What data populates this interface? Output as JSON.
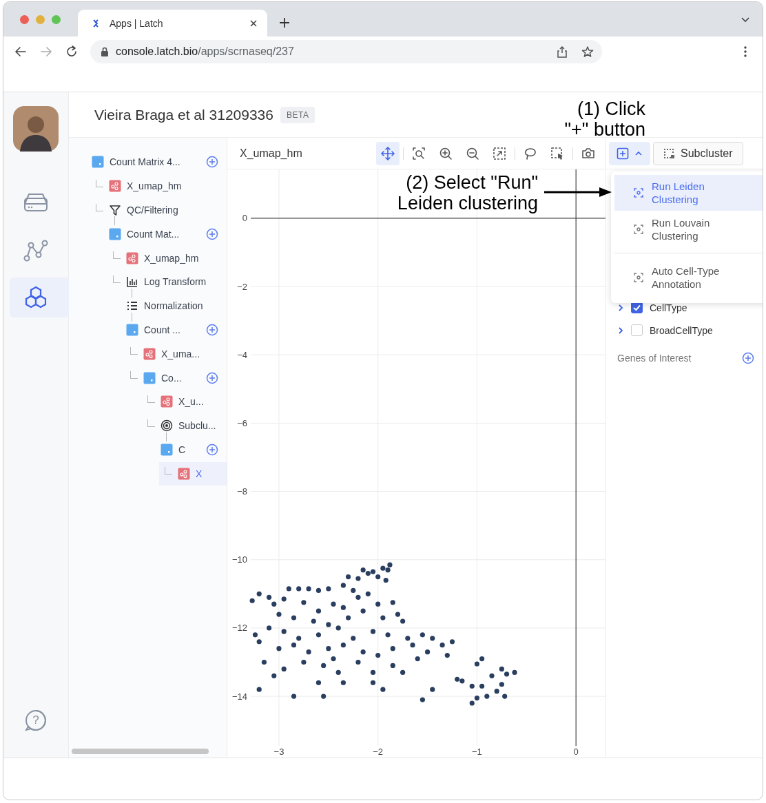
{
  "browser": {
    "tab_title": "Apps | Latch",
    "url": "console.latch.bio/apps/scrnaseq/237"
  },
  "rail": {
    "items": [
      {
        "kind": "drive",
        "selected": false
      },
      {
        "kind": "graph",
        "selected": false
      },
      {
        "kind": "cells",
        "selected": true
      }
    ],
    "help_glyph": "?"
  },
  "header": {
    "title": "Vieira Braga et al 31209336",
    "badge": "BETA"
  },
  "tree": [
    {
      "label": "Count Matrix 4...",
      "kind": "matrix",
      "add": true,
      "selected": false,
      "children": [
        {
          "label": "X_umap_hm",
          "kind": "umap",
          "add": false,
          "selected": false
        },
        {
          "label": "QC/Filtering",
          "kind": "filter",
          "add": false,
          "selected": false,
          "children": [
            {
              "label": "Count Mat...",
              "kind": "matrix",
              "add": true,
              "selected": false,
              "children": [
                {
                  "label": "X_umap_hm",
                  "kind": "umap",
                  "add": false,
                  "selected": false
                },
                {
                  "label": "Log Transform",
                  "kind": "bars",
                  "add": false,
                  "selected": false,
                  "children": [
                    {
                      "label": "Normalization",
                      "kind": "list",
                      "add": false,
                      "selected": false,
                      "children": [
                        {
                          "label": "Count ...",
                          "kind": "matrix",
                          "add": true,
                          "selected": false,
                          "children": [
                            {
                              "label": "X_uma...",
                              "kind": "umap",
                              "add": false,
                              "selected": false
                            },
                            {
                              "label": "Co...",
                              "kind": "matrix",
                              "add": true,
                              "selected": false,
                              "children": [
                                {
                                  "label": "X_u...",
                                  "kind": "umap",
                                  "add": false,
                                  "selected": false
                                },
                                {
                                  "label": "Subclu...",
                                  "kind": "target",
                                  "add": false,
                                  "selected": false,
                                  "children": [
                                    {
                                      "label": "C",
                                      "kind": "matrix",
                                      "add": true,
                                      "selected": false,
                                      "children": [
                                        {
                                          "label": "X",
                                          "kind": "umap",
                                          "add": false,
                                          "selected": true
                                        }
                                      ]
                                    }
                                  ]
                                }
                              ]
                            }
                          ]
                        }
                      ]
                    }
                  ]
                }
              ]
            }
          ]
        }
      ]
    }
  ],
  "plot": {
    "title": "X_umap_hm",
    "tool_groups": [
      [
        {
          "kind": "pan",
          "selected": true
        }
      ],
      [
        {
          "kind": "zoom-box",
          "selected": false
        },
        {
          "kind": "zoom-in",
          "selected": false
        },
        {
          "kind": "zoom-out",
          "selected": false
        },
        {
          "kind": "autoscale",
          "selected": false
        }
      ],
      [
        {
          "kind": "lasso",
          "selected": false
        },
        {
          "kind": "box-select",
          "selected": false
        }
      ],
      [
        {
          "kind": "camera",
          "selected": false
        }
      ]
    ],
    "chart_data": {
      "type": "scatter",
      "grid": true,
      "xlim": [
        -3.285,
        0.298
      ],
      "ylim": [
        -15.45,
        1.43
      ],
      "xticks": [
        {
          "value": -3,
          "label": "−3"
        },
        {
          "value": -2,
          "label": "−2"
        },
        {
          "value": -1,
          "label": "−1"
        },
        {
          "value": 0,
          "label": "0"
        }
      ],
      "yticks": [
        {
          "value": 0,
          "label": "0"
        },
        {
          "value": -2,
          "label": "−2"
        },
        {
          "value": -4,
          "label": "−4"
        },
        {
          "value": -6,
          "label": "−6"
        },
        {
          "value": -8,
          "label": "−8"
        },
        {
          "value": -10,
          "label": "−10"
        },
        {
          "value": -12,
          "label": "−12"
        },
        {
          "value": -14,
          "label": "−14"
        }
      ],
      "x": [
        -2.15,
        -2.1,
        -2.05,
        -1.95,
        -1.9,
        -1.88,
        -2.0,
        -1.92,
        -2.2,
        -2.3,
        -2.35,
        -2.25,
        -3.27,
        -3.2,
        -3.1,
        -3.05,
        -2.9,
        -2.8,
        -2.7,
        -2.6,
        -2.5,
        -2.95,
        -2.75,
        -2.6,
        -2.45,
        -2.35,
        -2.2,
        -2.1,
        -2.0,
        -1.85,
        -1.8,
        -3.0,
        -2.85,
        -2.65,
        -2.5,
        -2.3,
        -2.15,
        -1.95,
        -1.75,
        -3.1,
        -2.95,
        -2.8,
        -2.6,
        -2.4,
        -2.25,
        -2.05,
        -1.9,
        -1.7,
        -1.55,
        -1.45,
        -3.2,
        -3.0,
        -2.85,
        -2.7,
        -2.5,
        -2.35,
        -2.15,
        -2.0,
        -1.85,
        -1.65,
        -1.35,
        -1.25,
        -1.3,
        -3.15,
        -2.95,
        -2.75,
        -2.55,
        -2.4,
        -2.2,
        -2.05,
        -1.85,
        -1.75,
        -3.05,
        -2.6,
        -2.35,
        -2.05,
        -1.95,
        -3.2,
        -2.85,
        -2.55,
        -3.24,
        -2.45,
        -1.6,
        -1.5,
        -1.2,
        -1.15,
        -1.05,
        -0.95,
        -0.85,
        -0.75,
        -0.7,
        -0.62,
        -0.75,
        -0.8,
        -0.9,
        -1.0,
        -1.05,
        -0.72,
        -0.95,
        -1.0,
        -1.55,
        -1.45
      ],
      "series": [
        {
          "color": "#2a3f5f",
          "values": [
            -10.3,
            -10.4,
            -10.35,
            -10.25,
            -10.3,
            -10.15,
            -10.5,
            -10.6,
            -10.55,
            -10.5,
            -10.75,
            -10.9,
            -11.2,
            -11.0,
            -11.1,
            -11.3,
            -10.85,
            -10.85,
            -10.85,
            -10.9,
            -10.85,
            -11.15,
            -11.25,
            -11.5,
            -11.3,
            -11.4,
            -11.1,
            -11.0,
            -11.3,
            -11.25,
            -11.6,
            -11.6,
            -11.7,
            -11.8,
            -11.9,
            -11.7,
            -11.5,
            -11.7,
            -11.8,
            -12.0,
            -12.1,
            -12.3,
            -12.2,
            -12.0,
            -12.3,
            -12.1,
            -12.2,
            -12.3,
            -12.2,
            -12.3,
            -12.4,
            -12.6,
            -12.5,
            -12.7,
            -12.6,
            -12.5,
            -12.7,
            -12.8,
            -12.6,
            -12.5,
            -12.5,
            -12.4,
            -12.8,
            -13.0,
            -13.2,
            -13.0,
            -13.1,
            -13.3,
            -13.0,
            -13.3,
            -13.1,
            -13.3,
            -13.4,
            -13.6,
            -13.6,
            -13.6,
            -13.8,
            -13.8,
            -14.0,
            -14.0,
            -12.2,
            -12.9,
            -12.9,
            -12.7,
            -13.5,
            -13.55,
            -13.7,
            -13.7,
            -13.4,
            -13.2,
            -13.35,
            -13.3,
            -13.65,
            -13.85,
            -14.0,
            -14.05,
            -14.2,
            -14.0,
            -12.9,
            -13.05,
            -14.1,
            -13.8
          ]
        }
      ]
    }
  },
  "actions": {
    "add_menu_expanded": true,
    "subcluster": "Subcluster"
  },
  "menu": {
    "items": [
      {
        "label": "Run Leiden Clustering",
        "selected": true,
        "separated": false
      },
      {
        "label": "Run Louvain Clustering",
        "selected": false,
        "separated": false
      },
      {
        "label": "Auto Cell-Type Annotation",
        "selected": false,
        "separated": true
      }
    ]
  },
  "right_panel": {
    "annotations": [
      {
        "label": "CellType",
        "checked": true
      },
      {
        "label": "BroadCellType",
        "checked": false
      }
    ],
    "genes_label": "Genes of Interest"
  },
  "callouts": [
    {
      "lines": [
        "(1) Click",
        "\"+\" button"
      ],
      "arrow": false
    },
    {
      "lines": [
        "(2) Select \"Run\"",
        "Leiden clustering"
      ],
      "arrow": true
    }
  ]
}
